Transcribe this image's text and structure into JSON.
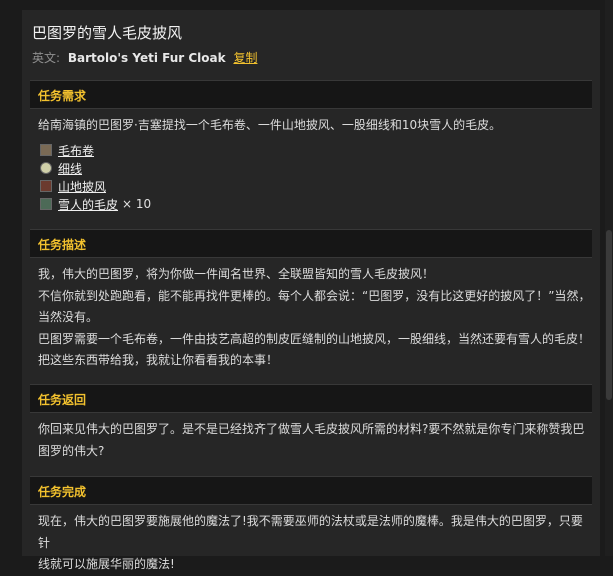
{
  "title": "巴图罗的雪人毛皮披风",
  "english": {
    "label": "英文:",
    "name": "Bartolo's Yeti Fur Cloak",
    "copy": "复制"
  },
  "requirements": {
    "header": "任务需求",
    "text": "给南海镇的巴图罗·吉塞提找一个毛布卷、一件山地披风、一股细线和10块雪人的毛皮。",
    "items": [
      {
        "name": "毛布卷",
        "icon": "wool-bolt-icon",
        "qty": ""
      },
      {
        "name": "细线",
        "icon": "fine-thread-icon",
        "qty": ""
      },
      {
        "name": "山地披风",
        "icon": "cloak-icon",
        "qty": ""
      },
      {
        "name": "雪人的毛皮",
        "icon": "yeti-fur-icon",
        "qty": "× 10"
      }
    ]
  },
  "description": {
    "header": "任务描述",
    "lines": [
      "我，伟大的巴图罗，将为你做一件闻名世界、全联盟皆知的雪人毛皮披风！",
      "不信你就到处跑跑看，能不能再找件更棒的。每个人都会说：“巴图罗，没有比这更好的披风了！”当然，",
      "当然没有。",
      "巴图罗需要一个毛布卷，一件由技艺高超的制皮匠缝制的山地披风，一股细线，当然还要有雪人的毛皮！",
      "把这些东西带给我，我就让你看看我的本事！"
    ]
  },
  "return": {
    "header": "任务返回",
    "lines": [
      "你回来见伟大的巴图罗了。是不是已经找齐了做雪人毛皮披风所需的材料?要不然就是你专门来称赞我巴",
      "图罗的伟大?"
    ]
  },
  "complete": {
    "header": "任务完成",
    "lines": [
      "现在，伟大的巴图罗要施展他的魔法了!我不需要巫师的法杖或是法师的魔棒。我是伟大的巴图罗，只要针",
      "线就可以施展华丽的魔法!"
    ]
  },
  "colors": {
    "accent": "#f2c12e",
    "background": "#262626",
    "header_bg": "#161616"
  }
}
